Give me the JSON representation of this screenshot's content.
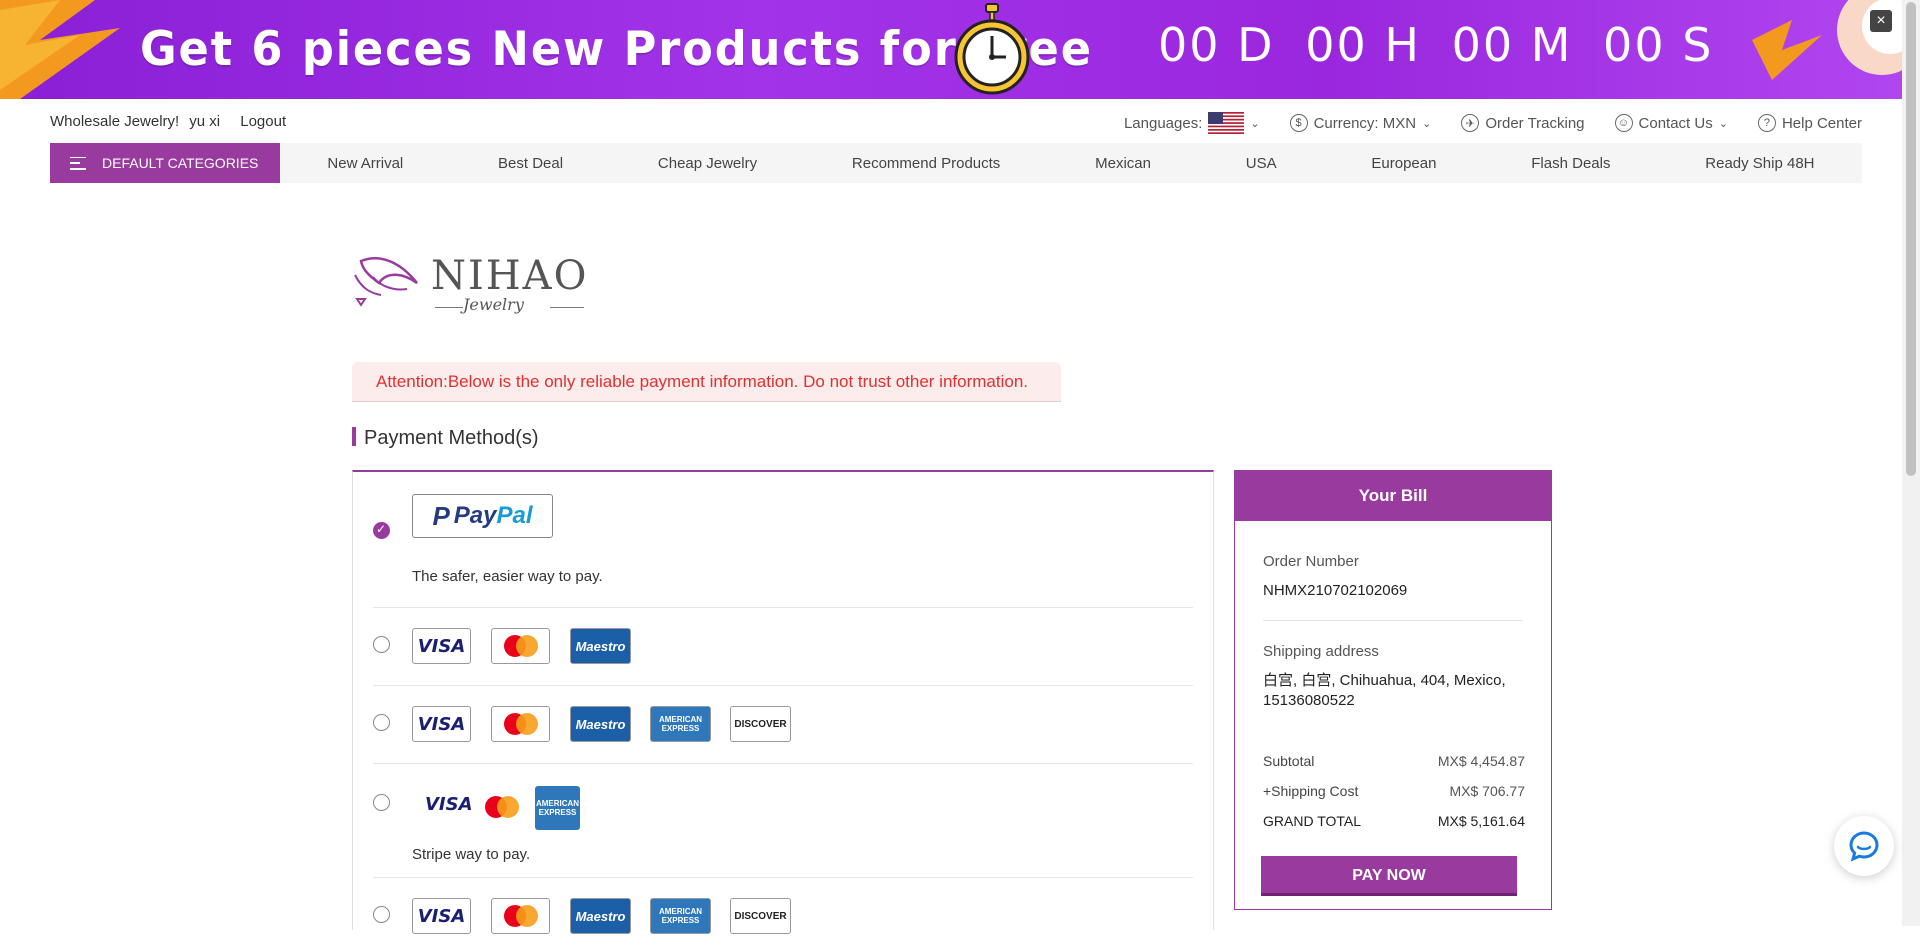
{
  "promo": {
    "headline": "Get 6 pieces New Products for Free",
    "countdown": [
      "00 D",
      "00 H",
      "00 M",
      "00 S"
    ],
    "close_label": "×"
  },
  "utilbar": {
    "greeting": "Wholesale Jewelry!",
    "username": "yu xi",
    "logout": "Logout",
    "languages_label": "Languages:",
    "currency_label": "Currency: MXN",
    "order_tracking": "Order Tracking",
    "contact_us": "Contact Us",
    "help_center": "Help Center"
  },
  "catnav": {
    "default_label": "DEFAULT CATEGORIES",
    "links": [
      "New Arrival",
      "Best Deal",
      "Cheap Jewelry",
      "Recommend Products",
      "Mexican",
      "USA",
      "European",
      "Flash Deals",
      "Ready Ship 48H"
    ]
  },
  "logo": {
    "brand": "NIHAO",
    "sub": "Jewelry"
  },
  "attention": "Attention:Below is the only reliable payment information. Do not trust other information.",
  "payment": {
    "header": "Payment Method(s)",
    "paypal_desc": "The safer, easier way to pay.",
    "stripe_desc": "Stripe way to pay.",
    "card_labels": {
      "visa": "VISA",
      "maestro": "Maestro",
      "amex": "AMERICAN EXPRESS",
      "discover": "DISCOVER"
    }
  },
  "bill": {
    "title": "Your Bill",
    "order_number_label": "Order Number",
    "order_number": "NHMX210702102069",
    "shipping_address_label": "Shipping address",
    "shipping_address": "白宫, 白宫, Chihuahua, 404, Mexico, 15136080522",
    "subtotal_label": "Subtotal",
    "subtotal": "MX$ 4,454.87",
    "shipping_label": "+Shipping Cost",
    "shipping": "MX$ 706.77",
    "grand_total_label": "GRAND TOTAL",
    "grand_total": "MX$ 5,161.64",
    "pay_now": "PAY NOW"
  },
  "colors": {
    "brand_purple": "#993a9e",
    "attention_red": "#e0312f"
  }
}
